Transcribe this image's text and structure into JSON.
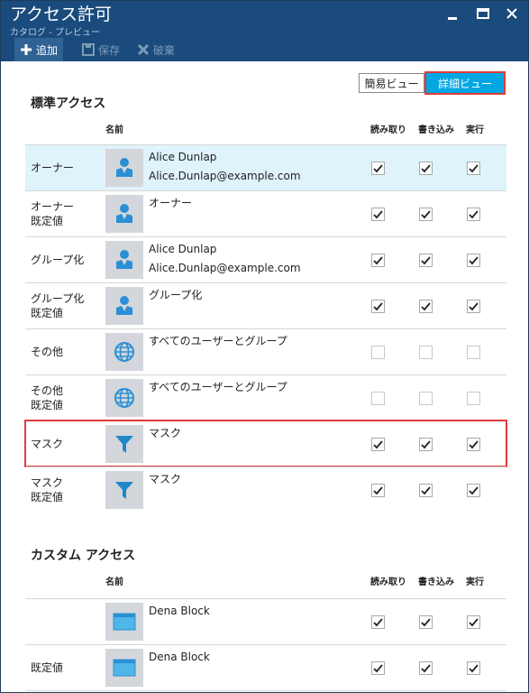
{
  "window": {
    "title": "アクセス許可",
    "subtitle": "カタログ - プレビュー",
    "minimize_icon": "minimize-icon",
    "maximize_icon": "maximize-icon",
    "close_icon": "close-icon"
  },
  "toolbar": {
    "add_label": "追加",
    "save_label": "保存",
    "discard_label": "破棄"
  },
  "view_toggle": {
    "simple_label": "簡易ビュー",
    "detail_label": "詳細ビュー",
    "selected": "詳細ビュー"
  },
  "standard": {
    "title": "標準アクセス",
    "col_name": "名前",
    "col_read": "読み取り",
    "col_write": "書き込み",
    "col_execute": "実行",
    "rows": [
      {
        "label": "オーナー",
        "name": "Alice Dunlap",
        "email": "Alice.Dunlap@example.com",
        "icon": "user-icon",
        "read": true,
        "write": true,
        "execute": true,
        "enabled": true
      },
      {
        "label": "オーナー\n既定値",
        "name": "オーナー",
        "email": "",
        "icon": "user-icon",
        "read": true,
        "write": true,
        "execute": true,
        "enabled": true
      },
      {
        "label": "グループ化",
        "name": "Alice Dunlap",
        "email": "Alice.Dunlap@example.com",
        "icon": "user-icon",
        "read": true,
        "write": true,
        "execute": true,
        "enabled": true
      },
      {
        "label": "グループ化\n既定値",
        "name": "グループ化",
        "email": "",
        "icon": "user-icon",
        "read": true,
        "write": true,
        "execute": true,
        "enabled": true
      },
      {
        "label": "その他",
        "name": "すべてのユーザーとグループ",
        "email": "",
        "icon": "globe-icon",
        "read": false,
        "write": false,
        "execute": false,
        "enabled": false
      },
      {
        "label": "その他\n既定値",
        "name": "すべてのユーザーとグループ",
        "email": "",
        "icon": "globe-icon",
        "read": false,
        "write": false,
        "execute": false,
        "enabled": false
      },
      {
        "label": "マスク",
        "name": "マスク",
        "email": "",
        "icon": "filter-icon",
        "read": true,
        "write": true,
        "execute": true,
        "enabled": true
      },
      {
        "label": "マスク\n既定値",
        "name": "マスク",
        "email": "",
        "icon": "filter-icon",
        "read": true,
        "write": true,
        "execute": true,
        "enabled": true
      }
    ]
  },
  "custom": {
    "title": "カスタム アクセス",
    "col_name": "名前",
    "col_read": "読み取り",
    "col_write": "書き込み",
    "col_execute": "実行",
    "rows": [
      {
        "label": "",
        "name": "Dena Block",
        "icon": "app-window-icon",
        "read": true,
        "write": true,
        "execute": true
      },
      {
        "label": "既定値",
        "name": "Dena Block",
        "icon": "app-window-icon",
        "read": true,
        "write": true,
        "execute": true
      }
    ]
  },
  "colors": {
    "title_bar": "#1a4b7c",
    "accent": "#00a7e3",
    "highlight_border": "#e03b3b",
    "selected_row": "#dff3fb",
    "icon_blue": "#2b8fd6"
  }
}
